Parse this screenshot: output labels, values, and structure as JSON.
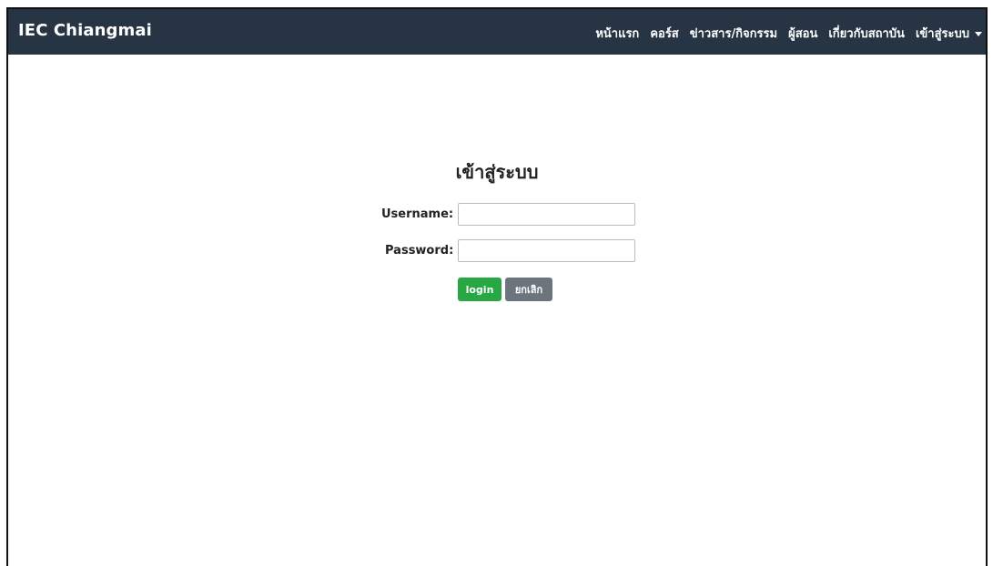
{
  "navbar": {
    "brand": "IEC Chiangmai",
    "items": [
      {
        "label": "หน้าแรก"
      },
      {
        "label": "คอร์ส"
      },
      {
        "label": "ข่าวสาร/กิจกรรม"
      },
      {
        "label": "ผู้สอน"
      },
      {
        "label": "เกี่ยวกับสถาบัน"
      },
      {
        "label": "เข้าสู่ระบบ"
      }
    ],
    "bg_color": "#263443"
  },
  "login_form": {
    "title": "เข้าสู่ระบบ",
    "username_label": "Username:",
    "username_value": "",
    "password_label": "Password:",
    "password_value": "",
    "login_button": "login",
    "cancel_button": "ยกเลิก",
    "login_color": "#28a745",
    "cancel_color": "#6c757d"
  }
}
